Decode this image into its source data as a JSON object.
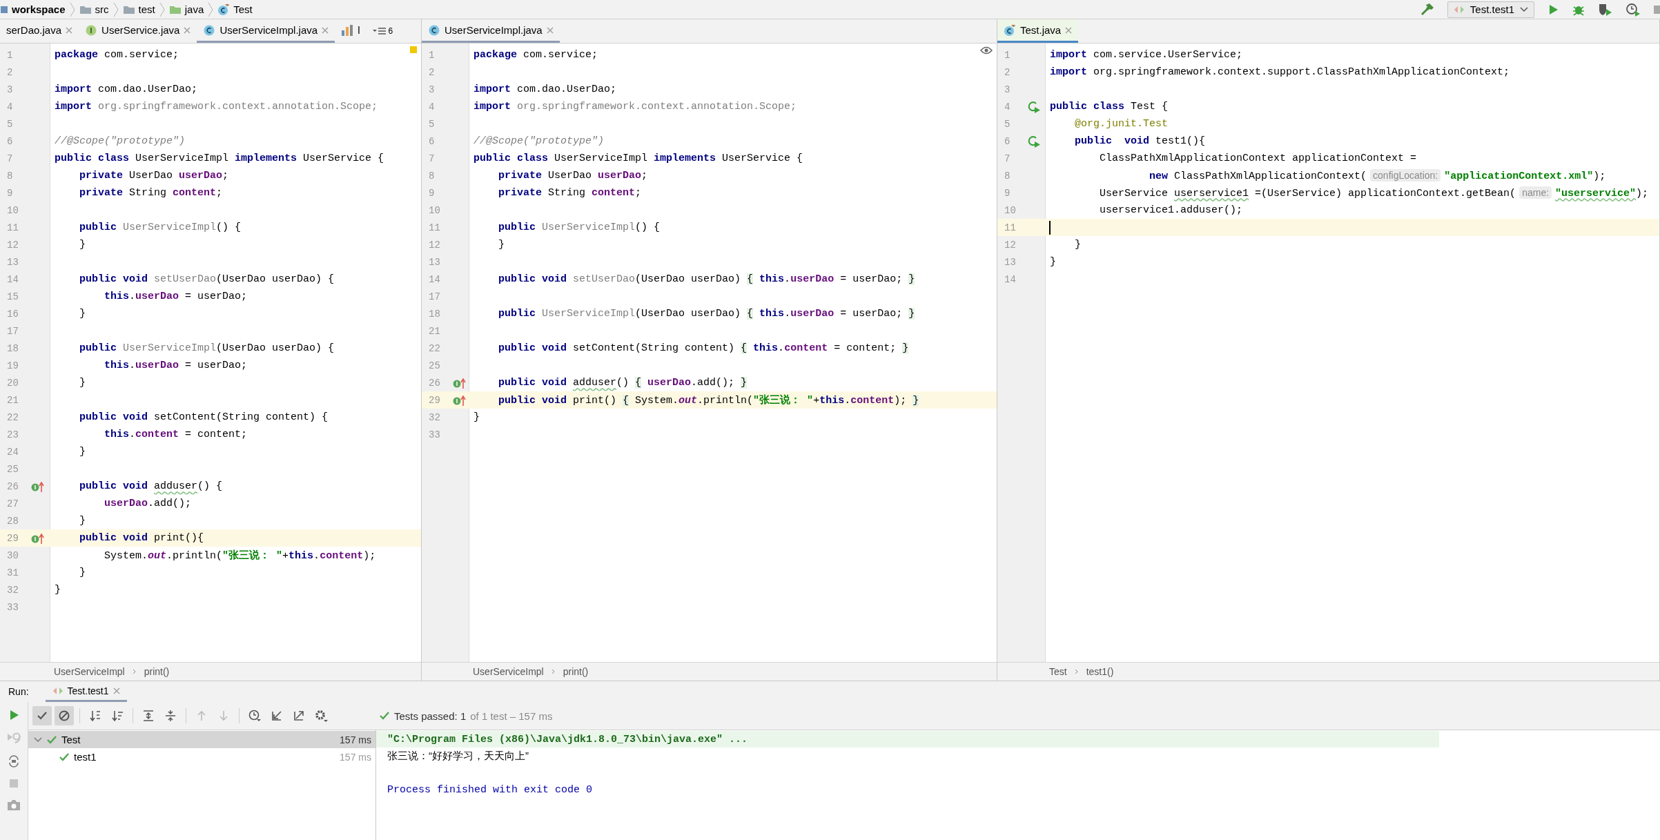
{
  "breadcrumb": [
    {
      "label": "workspace",
      "kind": "module"
    },
    {
      "label": "src",
      "kind": "folder"
    },
    {
      "label": "test",
      "kind": "folder"
    },
    {
      "label": "java",
      "kind": "source"
    },
    {
      "label": "Test",
      "kind": "test_class"
    }
  ],
  "run_config": "Test.test1",
  "editors": [
    {
      "focused": false,
      "status_mark": {
        "kind": "warning"
      },
      "overflow_count": "6",
      "tabs": [
        {
          "label": "serDao.java",
          "kind": "none",
          "selected": false,
          "closable": true
        },
        {
          "label": "UserService.java",
          "kind": "interface",
          "selected": false,
          "closable": true
        },
        {
          "label": "UserServiceImpl.java",
          "kind": "class",
          "selected": true,
          "closable": true
        },
        {
          "label": "l",
          "kind": "chart",
          "selected": false,
          "closable": false
        }
      ],
      "lines": [
        {
          "n": "1",
          "current": false,
          "code": [
            {
              "kind": "kw",
              "text": "package"
            },
            {
              "kind": "plain",
              "text": " com.service;"
            }
          ]
        },
        {
          "n": "2",
          "current": false
        },
        {
          "n": "3",
          "current": false,
          "code": [
            {
              "kind": "kw",
              "text": "import"
            },
            {
              "kind": "plain",
              "text": " com.dao.UserDao;"
            }
          ]
        },
        {
          "n": "4",
          "current": false,
          "code": [
            {
              "kind": "kw",
              "text": "import"
            },
            {
              "kind": "unused",
              "text": " org.springframework.context.annotation.Scope;"
            }
          ]
        },
        {
          "n": "5",
          "current": false
        },
        {
          "n": "6",
          "current": false,
          "code": [
            {
              "kind": "comment",
              "text": "//@Scope(\"prototype\")"
            }
          ]
        },
        {
          "n": "7",
          "current": false,
          "code": [
            {
              "kind": "kw",
              "text": "public class"
            },
            {
              "kind": "plain",
              "text": " UserServiceImpl "
            },
            {
              "kind": "kw",
              "text": "implements"
            },
            {
              "kind": "plain",
              "text": " UserService {"
            }
          ]
        },
        {
          "n": "8",
          "current": false,
          "code": [
            {
              "kind": "kw",
              "text": "    private"
            },
            {
              "kind": "plain",
              "text": " UserDao "
            },
            {
              "kind": "field",
              "text": "userDao"
            },
            {
              "kind": "plain",
              "text": ";"
            }
          ]
        },
        {
          "n": "9",
          "current": false,
          "code": [
            {
              "kind": "kw",
              "text": "    private"
            },
            {
              "kind": "plain",
              "text": " String "
            },
            {
              "kind": "field",
              "text": "content"
            },
            {
              "kind": "plain",
              "text": ";"
            }
          ]
        },
        {
          "n": "10",
          "current": false
        },
        {
          "n": "11",
          "current": false,
          "code": [
            {
              "kind": "kw",
              "text": "    public "
            },
            {
              "kind": "unused",
              "text": "UserServiceImpl"
            },
            {
              "kind": "plain",
              "text": "() {"
            }
          ]
        },
        {
          "n": "12",
          "current": false,
          "code": [
            {
              "kind": "plain",
              "text": "    }"
            }
          ]
        },
        {
          "n": "13",
          "current": false
        },
        {
          "n": "14",
          "current": false,
          "code": [
            {
              "kind": "kw",
              "text": "    public void "
            },
            {
              "kind": "unused",
              "text": "setUserDao"
            },
            {
              "kind": "plain",
              "text": "(UserDao userDao) {"
            }
          ]
        },
        {
          "n": "15",
          "current": false,
          "code": [
            {
              "kind": "kw",
              "text": "        this"
            },
            {
              "kind": "plain",
              "text": "."
            },
            {
              "kind": "field",
              "text": "userDao"
            },
            {
              "kind": "plain",
              "text": " = userDao;"
            }
          ]
        },
        {
          "n": "16",
          "current": false,
          "code": [
            {
              "kind": "plain",
              "text": "    }"
            }
          ]
        },
        {
          "n": "17",
          "current": false
        },
        {
          "n": "18",
          "current": false,
          "code": [
            {
              "kind": "kw",
              "text": "    public "
            },
            {
              "kind": "unused",
              "text": "UserServiceImpl"
            },
            {
              "kind": "plain",
              "text": "(UserDao userDao) {"
            }
          ]
        },
        {
          "n": "19",
          "current": false,
          "code": [
            {
              "kind": "kw",
              "text": "        this"
            },
            {
              "kind": "plain",
              "text": "."
            },
            {
              "kind": "field",
              "text": "userDao"
            },
            {
              "kind": "plain",
              "text": " = userDao;"
            }
          ]
        },
        {
          "n": "20",
          "current": false,
          "code": [
            {
              "kind": "plain",
              "text": "    }"
            }
          ]
        },
        {
          "n": "21",
          "current": false
        },
        {
          "n": "22",
          "current": false,
          "code": [
            {
              "kind": "kw",
              "text": "    public void"
            },
            {
              "kind": "plain",
              "text": " setContent(String content) {"
            }
          ]
        },
        {
          "n": "23",
          "current": false,
          "code": [
            {
              "kind": "kw",
              "text": "        this"
            },
            {
              "kind": "plain",
              "text": "."
            },
            {
              "kind": "field",
              "text": "content"
            },
            {
              "kind": "plain",
              "text": " = content;"
            }
          ]
        },
        {
          "n": "24",
          "current": false,
          "code": [
            {
              "kind": "plain",
              "text": "    }"
            }
          ]
        },
        {
          "n": "25",
          "current": false
        },
        {
          "n": "26",
          "current": false,
          "marker": {
            "kind": "implements"
          },
          "code": [
            {
              "kind": "kw",
              "text": "    public void "
            },
            {
              "kind": "typo",
              "text": "adduser"
            },
            {
              "kind": "plain",
              "text": "() {"
            }
          ]
        },
        {
          "n": "27",
          "current": false,
          "code": [
            {
              "kind": "field",
              "text": "        userDao"
            },
            {
              "kind": "plain",
              "text": ".add();"
            }
          ]
        },
        {
          "n": "28",
          "current": false,
          "code": [
            {
              "kind": "plain",
              "text": "    }"
            }
          ]
        },
        {
          "n": "29",
          "current": true,
          "marker": {
            "kind": "implements"
          },
          "code": [
            {
              "kind": "kw",
              "text": "    public void"
            },
            {
              "kind": "plain",
              "text": " print(){"
            }
          ]
        },
        {
          "n": "30",
          "current": false,
          "code": [
            {
              "kind": "plain",
              "text": "        System."
            },
            {
              "kind": "static",
              "text": "out"
            },
            {
              "kind": "plain",
              "text": ".println("
            },
            {
              "kind": "string",
              "text": "\"张三说： \""
            },
            {
              "kind": "plain",
              "text": "+"
            },
            {
              "kind": "kw",
              "text": "this"
            },
            {
              "kind": "plain",
              "text": "."
            },
            {
              "kind": "field",
              "text": "content"
            },
            {
              "kind": "plain",
              "text": ");"
            }
          ]
        },
        {
          "n": "31",
          "current": false,
          "code": [
            {
              "kind": "plain",
              "text": "    }"
            }
          ]
        },
        {
          "n": "32",
          "current": false,
          "code": [
            {
              "kind": "plain",
              "text": "}"
            }
          ]
        },
        {
          "n": "33",
          "current": false
        }
      ],
      "path": [
        "UserServiceImpl",
        "print()"
      ]
    },
    {
      "focused": false,
      "status_mark": {
        "kind": "eye"
      },
      "tabs": [
        {
          "label": "UserServiceImpl.java",
          "kind": "class",
          "selected": true,
          "closable": true
        }
      ],
      "lines": [
        {
          "n": "1",
          "current": false,
          "code": [
            {
              "kind": "kw",
              "text": "package"
            },
            {
              "kind": "plain",
              "text": " com.service;"
            }
          ]
        },
        {
          "n": "2",
          "current": false
        },
        {
          "n": "3",
          "current": false,
          "code": [
            {
              "kind": "kw",
              "text": "import"
            },
            {
              "kind": "plain",
              "text": " com.dao.UserDao;"
            }
          ]
        },
        {
          "n": "4",
          "current": false,
          "code": [
            {
              "kind": "kw",
              "text": "import"
            },
            {
              "kind": "unused",
              "text": " org.springframework.context.annotation.Scope;"
            }
          ]
        },
        {
          "n": "5",
          "current": false
        },
        {
          "n": "6",
          "current": false,
          "code": [
            {
              "kind": "comment",
              "text": "//@Scope(\"prototype\")"
            }
          ]
        },
        {
          "n": "7",
          "current": false,
          "code": [
            {
              "kind": "kw",
              "text": "public class"
            },
            {
              "kind": "plain",
              "text": " UserServiceImpl "
            },
            {
              "kind": "kw",
              "text": "implements"
            },
            {
              "kind": "plain",
              "text": " UserService {"
            }
          ]
        },
        {
          "n": "8",
          "current": false,
          "code": [
            {
              "kind": "kw",
              "text": "    private"
            },
            {
              "kind": "plain",
              "text": " UserDao "
            },
            {
              "kind": "field",
              "text": "userDao"
            },
            {
              "kind": "plain",
              "text": ";"
            }
          ]
        },
        {
          "n": "9",
          "current": false,
          "code": [
            {
              "kind": "kw",
              "text": "    private"
            },
            {
              "kind": "plain",
              "text": " String "
            },
            {
              "kind": "field",
              "text": "content"
            },
            {
              "kind": "plain",
              "text": ";"
            }
          ]
        },
        {
          "n": "10",
          "current": false
        },
        {
          "n": "11",
          "current": false,
          "code": [
            {
              "kind": "kw",
              "text": "    public "
            },
            {
              "kind": "unused",
              "text": "UserServiceImpl"
            },
            {
              "kind": "plain",
              "text": "() {"
            }
          ]
        },
        {
          "n": "12",
          "current": false,
          "code": [
            {
              "kind": "plain",
              "text": "    }"
            }
          ]
        },
        {
          "n": "13",
          "current": false
        },
        {
          "n": "14",
          "current": false,
          "code": [
            {
              "kind": "kw",
              "text": "    public void "
            },
            {
              "kind": "unused",
              "text": "setUserDao"
            },
            {
              "kind": "plain",
              "text": "(UserDao userDao) "
            },
            {
              "kind": "fold",
              "text": "{"
            },
            {
              "kind": "kw",
              "text": " this"
            },
            {
              "kind": "plain",
              "text": "."
            },
            {
              "kind": "field",
              "text": "userDao"
            },
            {
              "kind": "plain",
              "text": " = userDao; "
            },
            {
              "kind": "fold",
              "text": "}"
            }
          ]
        },
        {
          "n": "17",
          "current": false
        },
        {
          "n": "18",
          "current": false,
          "code": [
            {
              "kind": "kw",
              "text": "    public "
            },
            {
              "kind": "unused",
              "text": "UserServiceImpl"
            },
            {
              "kind": "plain",
              "text": "(UserDao userDao) "
            },
            {
              "kind": "fold",
              "text": "{"
            },
            {
              "kind": "kw",
              "text": " this"
            },
            {
              "kind": "plain",
              "text": "."
            },
            {
              "kind": "field",
              "text": "userDao"
            },
            {
              "kind": "plain",
              "text": " = userDao; "
            },
            {
              "kind": "fold",
              "text": "}"
            }
          ]
        },
        {
          "n": "21",
          "current": false
        },
        {
          "n": "22",
          "current": false,
          "code": [
            {
              "kind": "kw",
              "text": "    public void"
            },
            {
              "kind": "plain",
              "text": " setContent(String content) "
            },
            {
              "kind": "fold",
              "text": "{"
            },
            {
              "kind": "kw",
              "text": " this"
            },
            {
              "kind": "plain",
              "text": "."
            },
            {
              "kind": "field",
              "text": "content"
            },
            {
              "kind": "plain",
              "text": " = content; "
            },
            {
              "kind": "fold",
              "text": "}"
            }
          ]
        },
        {
          "n": "25",
          "current": false
        },
        {
          "n": "26",
          "current": false,
          "marker": {
            "kind": "implements"
          },
          "code": [
            {
              "kind": "kw",
              "text": "    public void "
            },
            {
              "kind": "typo",
              "text": "adduser"
            },
            {
              "kind": "plain",
              "text": "() "
            },
            {
              "kind": "fold",
              "text": "{"
            },
            {
              "kind": "field",
              "text": " userDao"
            },
            {
              "kind": "plain",
              "text": ".add(); "
            },
            {
              "kind": "fold",
              "text": "}"
            }
          ]
        },
        {
          "n": "29",
          "current": true,
          "marker": {
            "kind": "implements"
          },
          "code": [
            {
              "kind": "kw",
              "text": "    public void"
            },
            {
              "kind": "plain",
              "text": " print() "
            },
            {
              "kind": "fold",
              "text": "{"
            },
            {
              "kind": "plain",
              "text": " System."
            },
            {
              "kind": "static",
              "text": "out"
            },
            {
              "kind": "plain",
              "text": ".println("
            },
            {
              "kind": "string",
              "text": "\"张三说： \""
            },
            {
              "kind": "plain",
              "text": "+"
            },
            {
              "kind": "kw",
              "text": "this"
            },
            {
              "kind": "plain",
              "text": "."
            },
            {
              "kind": "field",
              "text": "content"
            },
            {
              "kind": "plain",
              "text": "); "
            },
            {
              "kind": "fold",
              "text": "}"
            }
          ]
        },
        {
          "n": "32",
          "current": false,
          "code": [
            {
              "kind": "plain",
              "text": "}"
            }
          ]
        },
        {
          "n": "33",
          "current": false
        }
      ],
      "path": [
        "UserServiceImpl",
        "print()"
      ]
    },
    {
      "focused": true,
      "tabs": [
        {
          "label": "Test.java",
          "kind": "test_class",
          "selected": true,
          "closable": true
        }
      ],
      "lines": [
        {
          "n": "1",
          "current": false,
          "code": [
            {
              "kind": "kw",
              "text": "import"
            },
            {
              "kind": "plain",
              "text": " com.service.UserService;"
            }
          ]
        },
        {
          "n": "2",
          "current": false,
          "code": [
            {
              "kind": "kw",
              "text": "import"
            },
            {
              "kind": "plain",
              "text": " org.springframework.context.support.ClassPathXmlApplicationContext;"
            }
          ]
        },
        {
          "n": "3",
          "current": false
        },
        {
          "n": "4",
          "current": false,
          "marker": {
            "kind": "run"
          },
          "code": [
            {
              "kind": "kw",
              "text": "public class"
            },
            {
              "kind": "plain",
              "text": " Test {"
            }
          ]
        },
        {
          "n": "5",
          "current": false,
          "code": [
            {
              "kind": "annotation",
              "text": "    @org.junit.Test"
            }
          ]
        },
        {
          "n": "6",
          "current": false,
          "marker": {
            "kind": "run"
          },
          "code": [
            {
              "kind": "kw",
              "text": "    public  void"
            },
            {
              "kind": "plain",
              "text": " test1(){"
            }
          ]
        },
        {
          "n": "7",
          "current": false,
          "code": [
            {
              "kind": "plain",
              "text": "        ClassPathXmlApplicationContext applicationContext ="
            }
          ]
        },
        {
          "n": "8",
          "current": false,
          "code": [
            {
              "kind": "kw",
              "text": "                new"
            },
            {
              "kind": "plain",
              "text": " ClassPathXmlApplicationContext("
            },
            {
              "kind": "hint",
              "text": "configLocation:"
            },
            {
              "kind": "string",
              "text": "\"applicationContext.xml\""
            },
            {
              "kind": "plain",
              "text": ");"
            }
          ]
        },
        {
          "n": "9",
          "current": false,
          "code": [
            {
              "kind": "plain",
              "text": "        UserService "
            },
            {
              "kind": "typo",
              "text": "userservice1"
            },
            {
              "kind": "plain",
              "text": " =(UserService) applicationContext.getBean("
            },
            {
              "kind": "hint",
              "text": "name:"
            },
            {
              "kind": "typostring",
              "text": "\"userservice\""
            },
            {
              "kind": "plain",
              "text": ");"
            }
          ]
        },
        {
          "n": "10",
          "current": false,
          "code": [
            {
              "kind": "plain",
              "text": "        userservice1.adduser();"
            }
          ]
        },
        {
          "n": "11",
          "current": true
        },
        {
          "n": "12",
          "current": false,
          "code": [
            {
              "kind": "plain",
              "text": "    }"
            }
          ]
        },
        {
          "n": "13",
          "current": false,
          "code": [
            {
              "kind": "plain",
              "text": "}"
            }
          ]
        },
        {
          "n": "14",
          "current": false
        }
      ],
      "path": [
        "Test",
        "test1()"
      ]
    }
  ],
  "run": {
    "label": "Run:",
    "tab": {
      "label": "Test.test1",
      "selected": true
    },
    "toolbar": [
      {
        "kind": "passed",
        "on": true
      },
      {
        "kind": "ignored",
        "on": true
      },
      {
        "kind": "sort_alpha",
        "on": false
      },
      {
        "kind": "sort_duration",
        "on": false
      },
      {
        "kind": "expand",
        "on": false
      },
      {
        "kind": "collapse",
        "on": false
      },
      {
        "kind": "prev",
        "on": false
      },
      {
        "kind": "next",
        "on": false
      },
      {
        "kind": "history",
        "on": false
      },
      {
        "kind": "import",
        "on": false
      },
      {
        "kind": "export",
        "on": false
      },
      {
        "kind": "settings",
        "on": false
      }
    ],
    "status": {
      "main": "Tests passed: 1",
      "rest": "of 1 test – 157 ms"
    },
    "tree": [
      {
        "label": "Test",
        "time": "157 ms",
        "selected": true,
        "expanded": true,
        "children": [
          {
            "label": "test1",
            "time": "157 ms",
            "selected": false
          }
        ]
      }
    ],
    "console": [
      {
        "kind": "command",
        "text": "\"C:\\Program Files (x86)\\Java\\jdk1.8.0_73\\bin\\java.exe\" ..."
      },
      {
        "kind": "output",
        "text": "张三说：“好好学习，天天向上”"
      },
      {
        "kind": "system",
        "text": "Process finished with exit code 0"
      }
    ]
  }
}
